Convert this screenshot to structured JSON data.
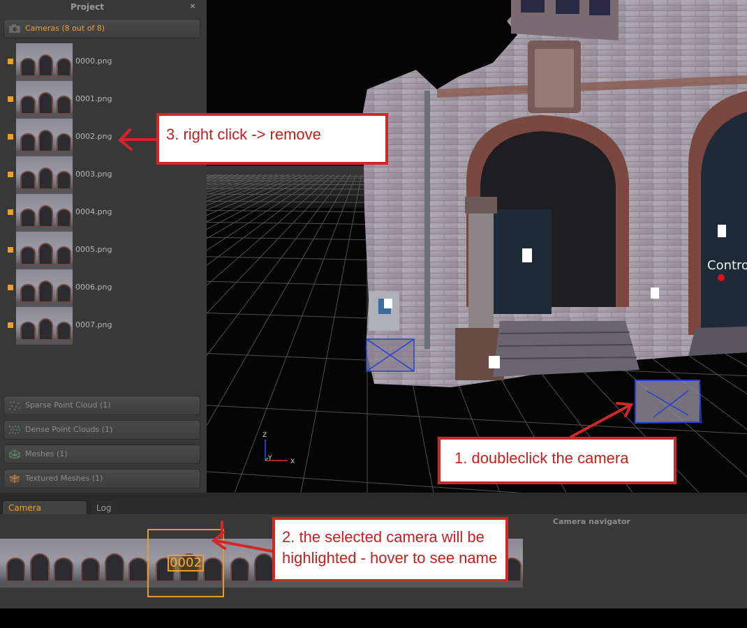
{
  "project_panel": {
    "title": "Project",
    "close_label": "×",
    "cameras_group_label": "Cameras (8 out of 8)",
    "cameras": [
      {
        "name": "0000.png"
      },
      {
        "name": "0001.png"
      },
      {
        "name": "0002.png"
      },
      {
        "name": "0003.png"
      },
      {
        "name": "0004.png"
      },
      {
        "name": "0005.png"
      },
      {
        "name": "0006.png"
      },
      {
        "name": "0007.png"
      }
    ],
    "groups": {
      "sparse": "Sparse Point Cloud (1)",
      "dense": "Dense Point Clouds (1)",
      "meshes": "Meshes (1)",
      "textured": "Textured Meshes (1)"
    }
  },
  "viewport": {
    "control_point_label": "Contro",
    "axis": {
      "z": "Z",
      "y": "Y",
      "x": "X"
    }
  },
  "bottom_tabs": {
    "camera_navigator": "Camera Navigator",
    "log": "Log"
  },
  "navigator": {
    "title": "Camera navigator",
    "selected_name": "0002"
  },
  "annotations": {
    "step1": "1. doubleclick the camera",
    "step2": "2. the selected camera will be highlighted - hover to see name",
    "step3": "3. right click -> remove"
  },
  "colors": {
    "accent_orange": "#f0a020",
    "annotation_red": "#d02828",
    "camera_frustum_blue": "#2a3fd0",
    "control_point_red": "#e01010"
  }
}
